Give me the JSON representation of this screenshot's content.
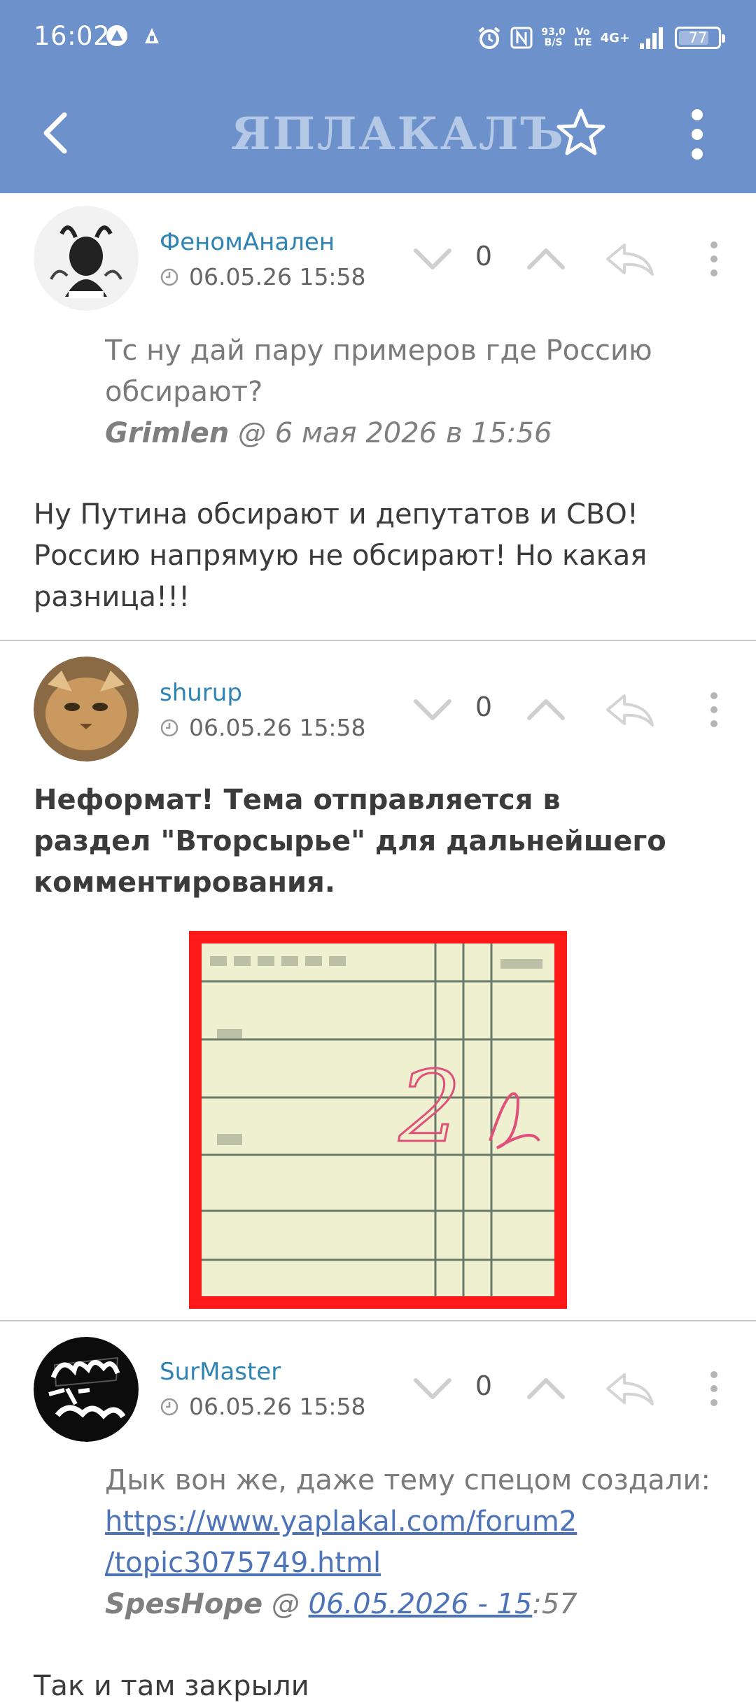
{
  "status_bar": {
    "time": "16:02",
    "net_speed_top": "93,0",
    "net_speed_bottom": "B/S",
    "volte_top": "Vo",
    "volte_bottom": "LTE",
    "network": "4G+",
    "battery": "77",
    "battery_level_percent": 77
  },
  "app_bar": {
    "logo": "ЯПЛАКАЛЪ"
  },
  "posts": [
    {
      "username": "ФеномАнален",
      "date": "06.05.26 15:58",
      "score": "0",
      "quote_lines": [
        "Тс ну дай пару примеров где Россию",
        "обсирают?"
      ],
      "quote_author": "Grimlen",
      "quote_sep": " @ ",
      "quote_date": "6 мая 2026 в 15:56",
      "body_lines": [
        "Ну Путина обсирают и депутатов и СВО!",
        "Россию напрямую не обсирают! Но какая",
        "разница!!!"
      ]
    },
    {
      "username": "shurup",
      "date": "06.05.26 15:58",
      "score": "0",
      "body_lines": [
        "Неформат! Тема отправляется в",
        "раздел \"Вторсырье\" для дальнейшего",
        "комментирования."
      ]
    },
    {
      "username": "SurMaster",
      "date": "06.05.26 15:58",
      "score": "0",
      "quote_text": "Дык вон же, даже тему спецом создали:",
      "quote_link_1": "https://www.yaplakal.com/forum2",
      "quote_link_2": "/topic3075749.html",
      "quote_author": "SpesHope",
      "quote_sep": " @ ",
      "quote_date_link": "06.05.2026 - 15",
      "quote_date_rest": ":57",
      "body_lines": [
        "Так и там закрыли"
      ]
    }
  ],
  "attachment": {
    "handwritten_mark": "2"
  },
  "colors": {
    "accent": "#6d92cb",
    "username": "#2f84b3",
    "link": "#4d74b8",
    "divider": "#c9c9c9"
  },
  "icons": [
    "back-arrow-icon",
    "star-icon",
    "more-vert-icon",
    "clock-icon",
    "chevron-down-icon",
    "chevron-up-icon",
    "reply-icon"
  ]
}
